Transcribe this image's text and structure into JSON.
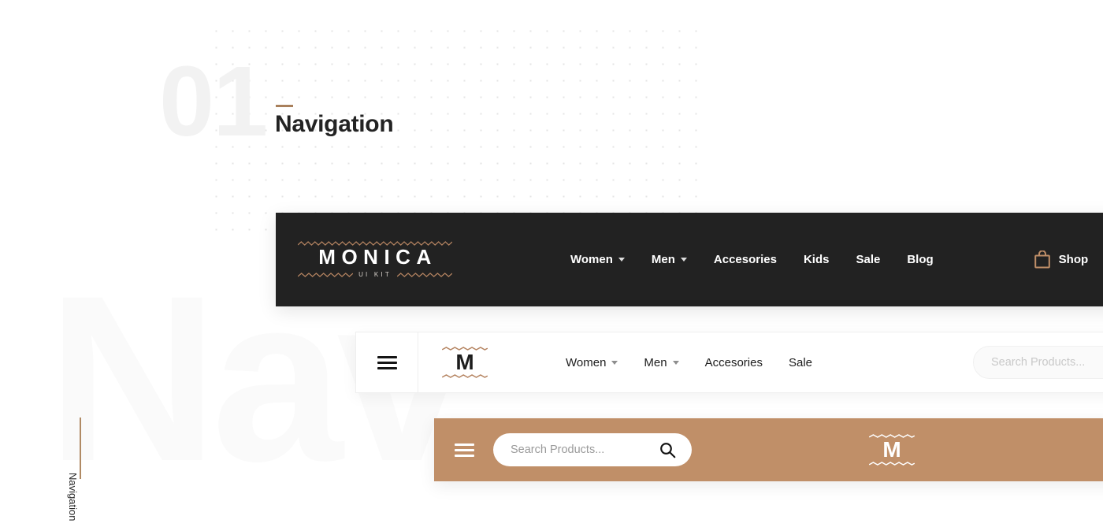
{
  "section": {
    "number": "01",
    "title": "Navigation",
    "side_label": "Navigation",
    "watermark": "Nav",
    "accent_color": "#a9805c"
  },
  "navbar_dark": {
    "background": "#222222",
    "brand": {
      "word": "MONICA",
      "subtitle": "UI KIT"
    },
    "menu": [
      {
        "label": "Women",
        "has_caret": true
      },
      {
        "label": "Men",
        "has_caret": true
      },
      {
        "label": "Accesories",
        "has_caret": false
      },
      {
        "label": "Kids",
        "has_caret": false
      },
      {
        "label": "Sale",
        "has_caret": false
      },
      {
        "label": "Blog",
        "has_caret": false
      }
    ],
    "shop": {
      "label": "Shop",
      "icon": "shopping-bag-icon",
      "icon_color": "#c08f68"
    }
  },
  "navbar_light": {
    "background": "#ffffff",
    "menu_icon": "hamburger-icon",
    "brand": {
      "word": "M"
    },
    "menu": [
      {
        "label": "Women",
        "has_caret": true
      },
      {
        "label": "Men",
        "has_caret": true
      },
      {
        "label": "Accesories",
        "has_caret": false
      },
      {
        "label": "Sale",
        "has_caret": false
      }
    ],
    "search": {
      "placeholder": "Search Products...",
      "value": ""
    }
  },
  "navbar_tan": {
    "background": "#c08f68",
    "menu_icon": "hamburger-icon",
    "brand": {
      "word": "M"
    },
    "search": {
      "placeholder": "Search Products...",
      "value": "",
      "icon": "search-icon"
    }
  }
}
